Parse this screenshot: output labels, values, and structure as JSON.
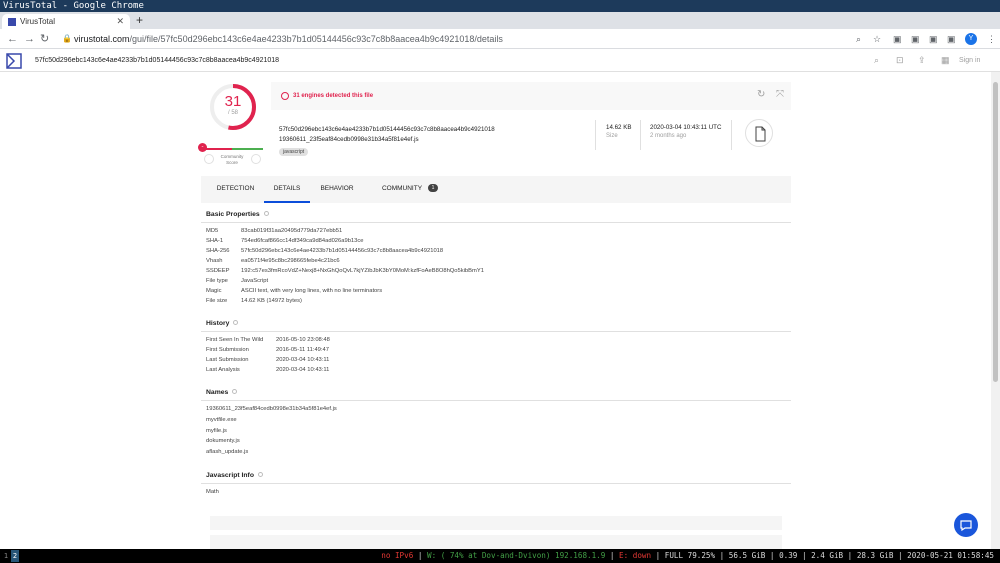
{
  "window": {
    "title": "VirusTotal - Google Chrome"
  },
  "browser": {
    "tab_title": "VirusTotal",
    "tab_close": "✕",
    "new_tab": "+",
    "url_host": "virustotal.com",
    "url_path": "/gui/file/57fc50d296ebc143c6e4ae4233b7b1d05144456c93c7c8b8aacea4b9c4921018/details",
    "avatar_letter": "Y"
  },
  "vt_header": {
    "search_value": "57fc50d296ebc143c6e4ae4233b7b1d05144456c93c7c8b8aacea4b9c4921018",
    "sign_in": "Sign in"
  },
  "summary": {
    "detections": "31",
    "engines_total": "/ 58",
    "detection_ratio": 0.534,
    "community_score_label": "Community Score",
    "community_score_value": "-",
    "detected_text": "31 engines detected this file",
    "sha256": "57fc50d296ebc143c6e4ae4233b7b1d05144456c93c7c8b8aacea4b9c4921018",
    "file_name": "19360611_23f5eaf84cedb0998e31b34a5f81e4ef.js",
    "tag": "javascript",
    "size_value": "14.62 KB",
    "size_label": "Size",
    "date_value": "2020-03-04 10:43:11 UTC",
    "date_label": "2 months ago"
  },
  "tabs": [
    {
      "label": "DETECTION"
    },
    {
      "label": "DETAILS",
      "active": true
    },
    {
      "label": "BEHAVIOR"
    },
    {
      "label": "COMMUNITY",
      "badge": "1"
    }
  ],
  "basic_properties": {
    "title": "Basic Properties",
    "rows": [
      {
        "label": "MD5",
        "value": "83cab019f31aa20495d779da727ebb51"
      },
      {
        "label": "SHA-1",
        "value": "754ed6fcaf866cc14df349ca9d84ad026a9b13ce"
      },
      {
        "label": "SHA-256",
        "value": "57fc50d296ebc143c6e4ae4233b7b1d05144456c93c7c8b8aacea4b9c4921018"
      },
      {
        "label": "Vhash",
        "value": "ea0571f4e95c8bc298665febe4c21bc6"
      },
      {
        "label": "SSDEEP",
        "value": "192:c57es3fmRcoVdZ+Nexj8+NxGhQoQvL7kjYZibJbK3bY0MoM:kzfFoAeB8O8hQo5kibBmY1"
      },
      {
        "label": "File type",
        "value": "JavaScript"
      },
      {
        "label": "Magic",
        "value": "ASCII text, with very long lines, with no line terminators"
      },
      {
        "label": "File size",
        "value": "14.62 KB (14972 bytes)"
      }
    ]
  },
  "history": {
    "title": "History",
    "rows": [
      {
        "label": "First Seen In The Wild",
        "value": "2016-05-10 23:08:48"
      },
      {
        "label": "First Submission",
        "value": "2016-05-11 11:49:47"
      },
      {
        "label": "Last Submission",
        "value": "2020-03-04 10:43:11"
      },
      {
        "label": "Last Analysis",
        "value": "2020-03-04 10:43:11"
      }
    ]
  },
  "names": {
    "title": "Names",
    "items": [
      "19360611_23f5eaf84cedb0998e31b34a5f81e4ef.js",
      "myvtfile.exe",
      "myfile.js",
      "dokumenty.js",
      "aflash_update.js"
    ]
  },
  "javascript_info": {
    "title": "Javascript Info",
    "value": "Math"
  },
  "statusbar": {
    "ws1": "1",
    "ws2": "2",
    "ipv6": "no IPv6",
    "wifi": "W: ( 74% at Dov-and-Dvivon) 192.168.1.9",
    "eth": "E: down",
    "disk": "FULL 79.25%",
    "mem": "56.5 GiB",
    "load": "0.39",
    "swap": "2.4 GiB",
    "free": "28.3 GiB",
    "datetime": "2020-05-21 01:58:45"
  },
  "colors": {
    "malicious": "#e0234e",
    "accent": "#0b4dda",
    "title_bar": "#1d3a5b"
  }
}
